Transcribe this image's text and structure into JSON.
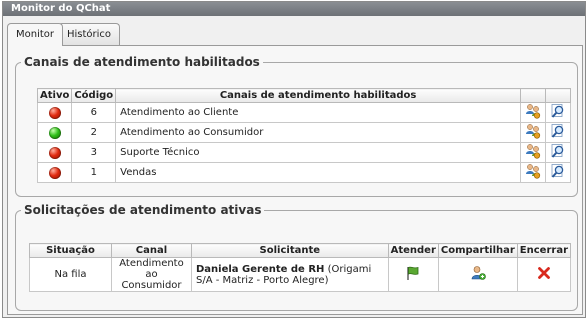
{
  "window": {
    "title": "Monitor do QChat"
  },
  "tabs": [
    {
      "label": "Monitor",
      "active": true
    },
    {
      "label": "Histórico",
      "active": false
    }
  ],
  "channels": {
    "legend": "Canais de atendimento habilitados",
    "headers": {
      "ativo": "Ativo",
      "codigo": "Código",
      "canal": "Canais de atendimento habilitados"
    },
    "rows": [
      {
        "status": "red",
        "code": "6",
        "name": "Atendimento ao Cliente"
      },
      {
        "status": "green",
        "code": "2",
        "name": "Atendimento ao Consumidor"
      },
      {
        "status": "red",
        "code": "3",
        "name": "Suporte Técnico"
      },
      {
        "status": "red",
        "code": "1",
        "name": "Vendas"
      }
    ],
    "row_icons": [
      "users-config-icon",
      "magnifier-icon"
    ]
  },
  "requests": {
    "legend": "Solicitações de atendimento ativas",
    "headers": {
      "situacao": "Situação",
      "canal": "Canal",
      "solicitante": "Solicitante",
      "atender": "Atender",
      "compartilhar": "Compartilhar",
      "encerrar": "Encerrar"
    },
    "rows": [
      {
        "situacao": "Na fila",
        "canal": "Atendimento ao Consumidor",
        "solicitante_name": "Daniela Gerente de RH",
        "solicitante_org": "(Origami S/A - Matriz - Porto Alegre)"
      }
    ],
    "action_icons": [
      "flag-icon",
      "share-user-icon",
      "close-x-icon"
    ]
  },
  "colors": {
    "active_red": "#e02a10",
    "active_green": "#2fbf1a",
    "titlebar": "#7a7e83"
  }
}
